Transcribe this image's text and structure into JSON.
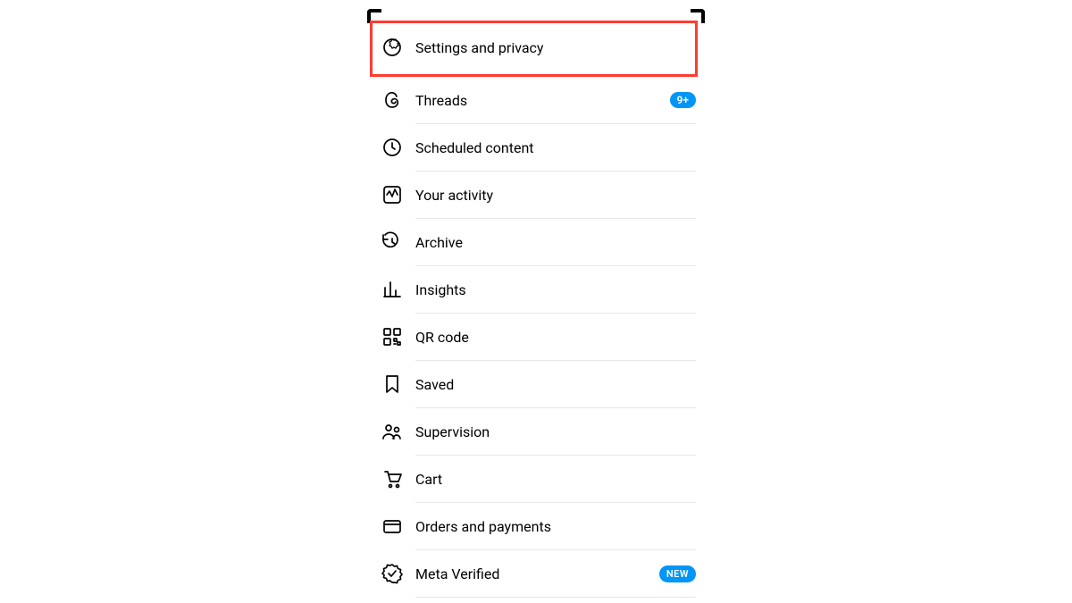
{
  "menu": {
    "highlight_color": "#ff3b30",
    "badge_color": "#0095f6",
    "items": [
      {
        "label": "Settings and privacy",
        "icon": "gear"
      },
      {
        "label": "Threads",
        "icon": "threads",
        "badge": "9+"
      },
      {
        "label": "Scheduled content",
        "icon": "clock"
      },
      {
        "label": "Your activity",
        "icon": "activity"
      },
      {
        "label": "Archive",
        "icon": "archive"
      },
      {
        "label": "Insights",
        "icon": "insights"
      },
      {
        "label": "QR code",
        "icon": "qr"
      },
      {
        "label": "Saved",
        "icon": "saved"
      },
      {
        "label": "Supervision",
        "icon": "supervision"
      },
      {
        "label": "Cart",
        "icon": "cart"
      },
      {
        "label": "Orders and payments",
        "icon": "card"
      },
      {
        "label": "Meta Verified",
        "icon": "verified",
        "badge": "NEW",
        "badge_type": "new"
      }
    ]
  }
}
